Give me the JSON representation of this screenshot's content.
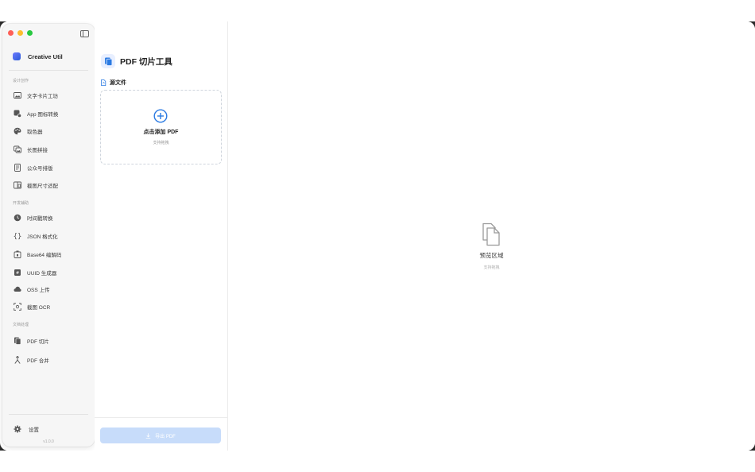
{
  "app": {
    "name": "Creative Util",
    "version": "v1.0.0"
  },
  "sidebar": {
    "sections": [
      {
        "label": "设计创作",
        "items": [
          {
            "label": "文字卡片工坊",
            "icon": "image-card-icon"
          },
          {
            "label": "App 图标转换",
            "icon": "app-icon-convert-icon"
          },
          {
            "label": "取色器",
            "icon": "palette-icon"
          },
          {
            "label": "长图拼接",
            "icon": "stitch-images-icon"
          },
          {
            "label": "公众号排版",
            "icon": "document-layout-icon"
          },
          {
            "label": "截图尺寸适配",
            "icon": "screenshot-resize-icon"
          }
        ]
      },
      {
        "label": "开发辅助",
        "items": [
          {
            "label": "时间戳转换",
            "icon": "clock-icon"
          },
          {
            "label": "JSON 格式化",
            "icon": "braces-icon"
          },
          {
            "label": "Base64 编解码",
            "icon": "base64-icon"
          },
          {
            "label": "UUID 生成器",
            "icon": "uuid-icon"
          },
          {
            "label": "OSS 上传",
            "icon": "cloud-icon"
          },
          {
            "label": "截图 OCR",
            "icon": "scan-icon"
          }
        ]
      },
      {
        "label": "文档处理",
        "items": [
          {
            "label": "PDF 切片",
            "icon": "pdf-pages-icon"
          },
          {
            "label": "PDF 合并",
            "icon": "merge-icon"
          }
        ]
      }
    ],
    "settings_label": "设置"
  },
  "tool": {
    "title": "PDF 切片工具",
    "source_label": "源文件",
    "dropzone_title": "点击添加 PDF",
    "dropzone_sub": "支持拖拽",
    "export_label": "导出 PDF"
  },
  "preview": {
    "title": "预览区域",
    "sub": "支持拖拽"
  },
  "colors": {
    "accent": "#2a7ae2",
    "export_disabled": "#c7dcfa"
  }
}
